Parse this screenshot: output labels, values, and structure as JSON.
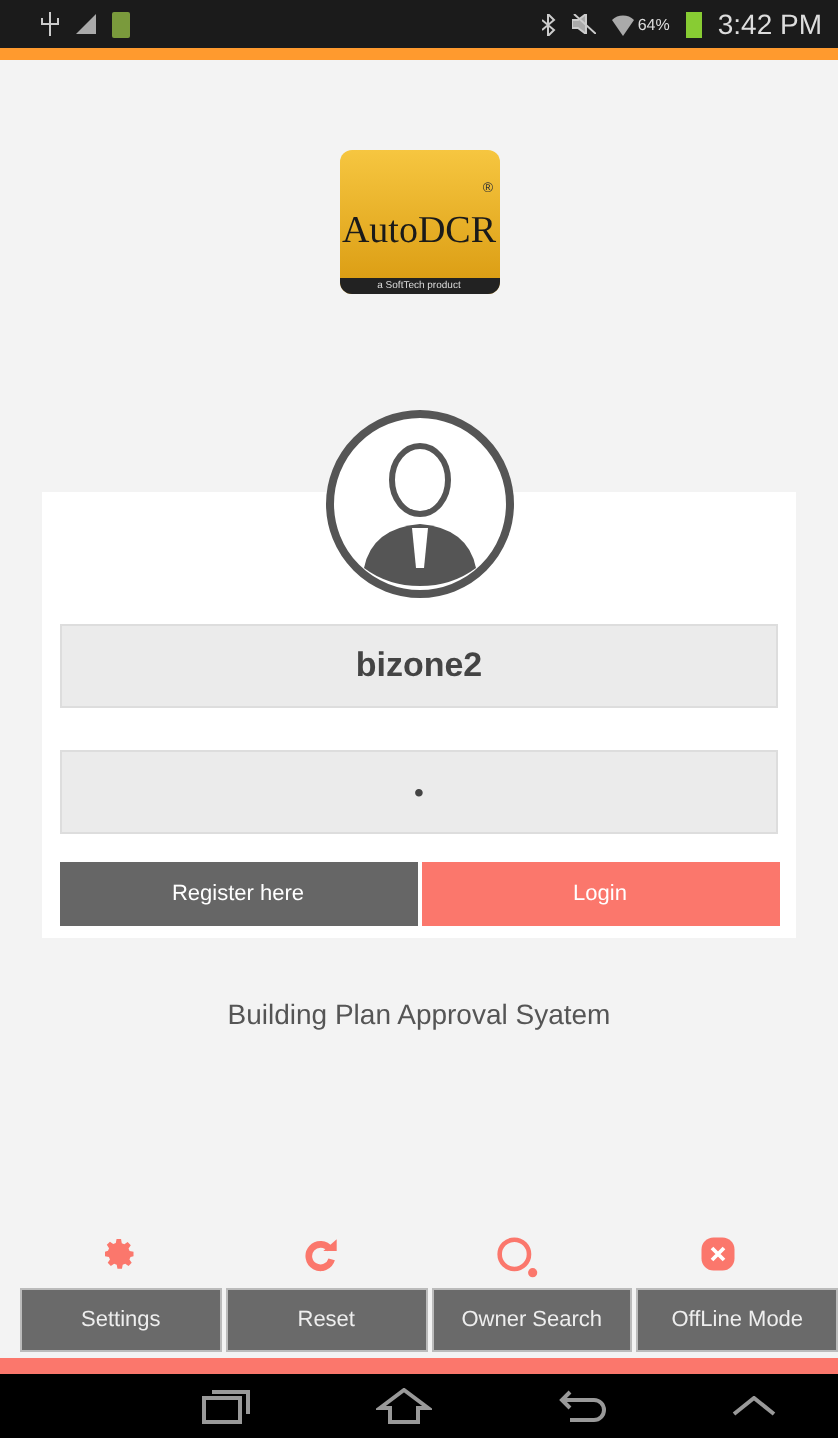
{
  "status_bar": {
    "battery": "64%",
    "time": "3:42 PM"
  },
  "logo": {
    "name": "AutoDCR",
    "mark": "®",
    "tagline": "a SoftTech product"
  },
  "login": {
    "username": "bizone2",
    "password": "•",
    "buttons": [
      {
        "label": "Register here",
        "kind": "secondary"
      },
      {
        "label": "Login",
        "kind": "primary"
      }
    ]
  },
  "subtitle": "Building Plan Approval Syatem",
  "bottom_actions": [
    {
      "label": "Settings",
      "kind": "settings"
    },
    {
      "label": "Reset",
      "kind": "reset"
    },
    {
      "label": "Owner Search",
      "kind": "search"
    },
    {
      "label": "OffLine Mode",
      "kind": "offline"
    }
  ]
}
